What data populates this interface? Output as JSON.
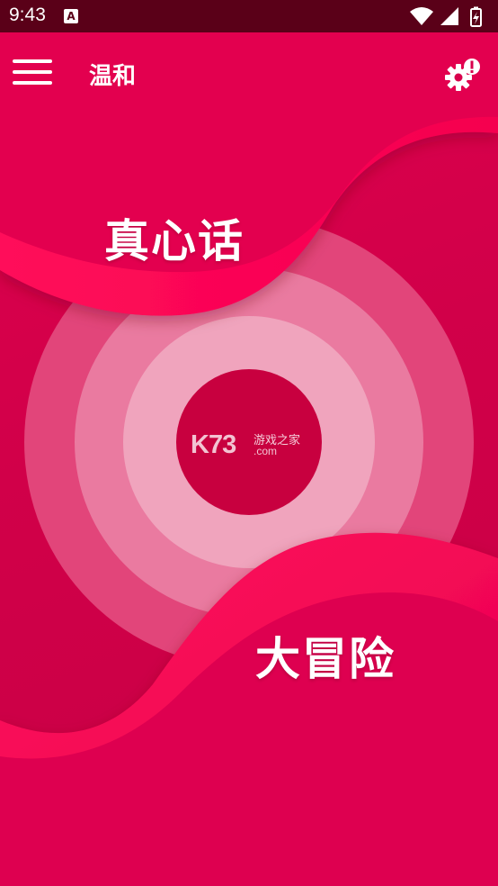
{
  "status_bar": {
    "time": "9:43",
    "notification_icon": "a-icon",
    "icons": [
      "wifi-icon",
      "signal-icon",
      "battery-icon"
    ]
  },
  "app_bar": {
    "title": "温和",
    "menu_icon": "hamburger-menu-icon",
    "settings_icon": "gear-alert-icon"
  },
  "choices": {
    "truth": "真心话",
    "dare": "大冒险"
  },
  "watermark": {
    "logo": "K73",
    "cn_text": "游戏之家",
    "domain": ".com"
  },
  "colors": {
    "primary": "#e0004e",
    "status_bar": "#5a0018",
    "wave": "#ff0a5a",
    "center": "#c8003f",
    "ring_light": "#f0a4bd"
  }
}
